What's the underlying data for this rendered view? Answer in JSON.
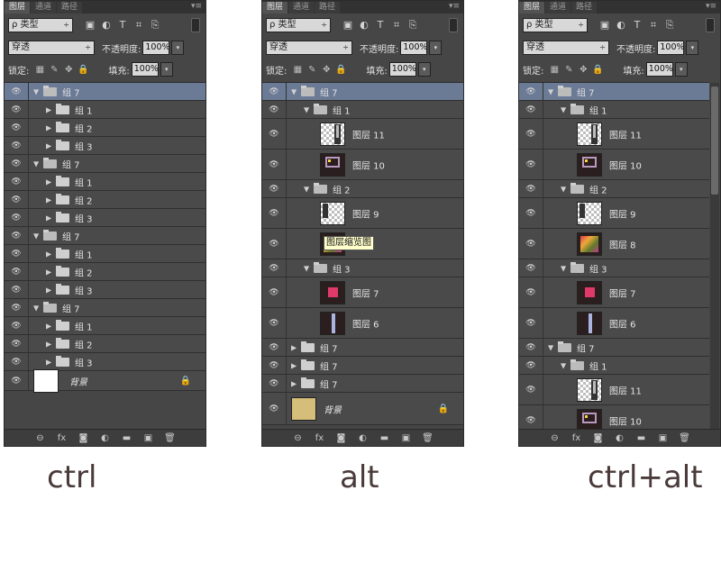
{
  "tabs": [
    "图层",
    "通道",
    "路径"
  ],
  "panel_menu_icon": "panel-menu-icon",
  "filter": {
    "label": "ρ 类型",
    "arrow": "÷"
  },
  "filter_icons": [
    "▣",
    "◐",
    "T",
    "⌗",
    "⎘"
  ],
  "blend": {
    "mode": "穿透",
    "opacity_label": "不透明度:",
    "opacity_value": "100%"
  },
  "lock": {
    "label": "锁定:",
    "fill_label": "填充:",
    "fill_value": "100%",
    "icons": [
      "▦",
      "✎",
      "✥",
      "🔒"
    ]
  },
  "footer_icons": [
    "⊖",
    "fx",
    "◙",
    "◐",
    "▬",
    "▣",
    "🗑"
  ],
  "tooltip": "图层缩览图",
  "captions": {
    "ctrl": "ctrl",
    "alt": "alt",
    "ctrlalt": "ctrl+alt"
  },
  "panels": {
    "ctrl": {
      "layers": [
        {
          "name": "组 7",
          "type": "group",
          "open": true,
          "indent": 0,
          "selected": true
        },
        {
          "name": "组 1",
          "type": "group",
          "open": false,
          "indent": 1
        },
        {
          "name": "组 2",
          "type": "group",
          "open": false,
          "indent": 1
        },
        {
          "name": "组 3",
          "type": "group",
          "open": false,
          "indent": 1
        },
        {
          "name": "组 7",
          "type": "group",
          "open": true,
          "indent": 0
        },
        {
          "name": "组 1",
          "type": "group",
          "open": false,
          "indent": 1
        },
        {
          "name": "组 2",
          "type": "group",
          "open": false,
          "indent": 1
        },
        {
          "name": "组 3",
          "type": "group",
          "open": false,
          "indent": 1
        },
        {
          "name": "组 7",
          "type": "group",
          "open": true,
          "indent": 0
        },
        {
          "name": "组 1",
          "type": "group",
          "open": false,
          "indent": 1
        },
        {
          "name": "组 2",
          "type": "group",
          "open": false,
          "indent": 1
        },
        {
          "name": "组 3",
          "type": "group",
          "open": false,
          "indent": 1
        },
        {
          "name": "组 7",
          "type": "group",
          "open": true,
          "indent": 0
        },
        {
          "name": "组 1",
          "type": "group",
          "open": false,
          "indent": 1
        },
        {
          "name": "组 2",
          "type": "group",
          "open": false,
          "indent": 1
        },
        {
          "name": "组 3",
          "type": "group",
          "open": false,
          "indent": 1
        },
        {
          "name": "背景",
          "type": "background",
          "thumb": "white",
          "locked": true
        }
      ]
    },
    "alt": {
      "layers": [
        {
          "name": "组 7",
          "type": "group",
          "open": true,
          "indent": 0,
          "selected": true
        },
        {
          "name": "组 1",
          "type": "group",
          "open": true,
          "indent": 1
        },
        {
          "name": "图层 11",
          "type": "layer",
          "thumb": "strip",
          "indent": 2
        },
        {
          "name": "图层 10",
          "type": "layer",
          "thumb": "frame",
          "indent": 2
        },
        {
          "name": "组 2",
          "type": "group",
          "open": true,
          "indent": 1
        },
        {
          "name": "图层 9",
          "type": "layer",
          "thumb": "strip2",
          "indent": 2
        },
        {
          "name": "",
          "type": "layer",
          "thumb": "colorful",
          "indent": 2,
          "tooltip": true
        },
        {
          "name": "组 3",
          "type": "group",
          "open": true,
          "indent": 1
        },
        {
          "name": "图层 7",
          "type": "layer",
          "thumb": "pink",
          "indent": 2
        },
        {
          "name": "图层 6",
          "type": "layer",
          "thumb": "darkbar",
          "indent": 2
        },
        {
          "name": "组 7",
          "type": "group",
          "open": false,
          "indent": 0
        },
        {
          "name": "组 7",
          "type": "group",
          "open": false,
          "indent": 0
        },
        {
          "name": "组 7",
          "type": "group",
          "open": false,
          "indent": 0
        },
        {
          "name": "背景",
          "type": "background",
          "thumb": "tan",
          "locked": true
        }
      ]
    },
    "ctrlalt": {
      "layers": [
        {
          "name": "组 7",
          "type": "group",
          "open": true,
          "indent": 0,
          "selected": true
        },
        {
          "name": "组 1",
          "type": "group",
          "open": true,
          "indent": 1
        },
        {
          "name": "图层 11",
          "type": "layer",
          "thumb": "strip",
          "indent": 2
        },
        {
          "name": "图层 10",
          "type": "layer",
          "thumb": "frame",
          "indent": 2
        },
        {
          "name": "组 2",
          "type": "group",
          "open": true,
          "indent": 1
        },
        {
          "name": "图层 9",
          "type": "layer",
          "thumb": "strip2",
          "indent": 2
        },
        {
          "name": "图层 8",
          "type": "layer",
          "thumb": "colorful",
          "indent": 2
        },
        {
          "name": "组 3",
          "type": "group",
          "open": true,
          "indent": 1
        },
        {
          "name": "图层 7",
          "type": "layer",
          "thumb": "pink",
          "indent": 2
        },
        {
          "name": "图层 6",
          "type": "layer",
          "thumb": "darkbar",
          "indent": 2
        },
        {
          "name": "组 7",
          "type": "group",
          "open": true,
          "indent": 0
        },
        {
          "name": "组 1",
          "type": "group",
          "open": true,
          "indent": 1
        },
        {
          "name": "图层 11",
          "type": "layer",
          "thumb": "strip",
          "indent": 2
        },
        {
          "name": "图层 10",
          "type": "layer",
          "thumb": "frame",
          "indent": 2
        }
      ]
    }
  }
}
